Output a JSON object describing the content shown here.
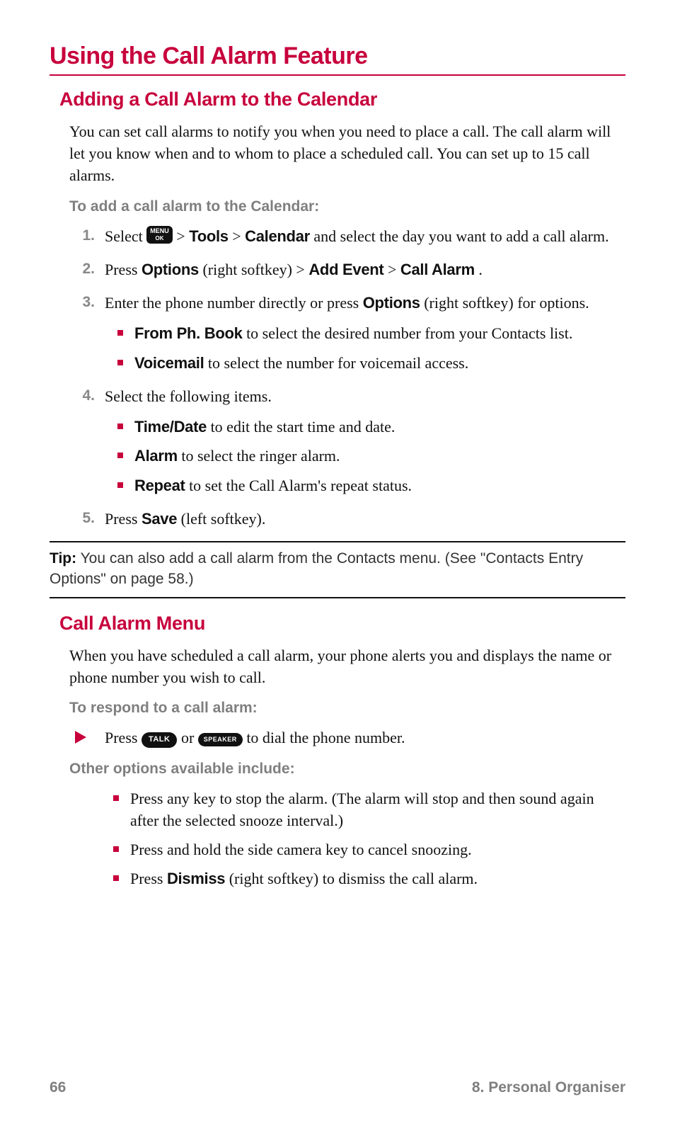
{
  "title": "Using the Call Alarm Feature",
  "section1": {
    "heading": "Adding a Call Alarm to the Calendar",
    "intro": "You can set call alarms to notify you when you need to place a call. The call alarm will let you know when and to whom to place a scheduled call. You can set up to 15 call alarms.",
    "lead": "To add a call alarm to the Calendar:",
    "steps": {
      "s1": {
        "pre": "Select ",
        "menu_top": "MENU",
        "menu_bot": "OK",
        "mid1": " > ",
        "b1": "Tools",
        "mid2": " > ",
        "b2": "Calendar",
        "post": " and select the day you want to add a call alarm."
      },
      "s2": {
        "pre": "Press ",
        "b1": "Options",
        "mid1": " (right softkey) > ",
        "b2": "Add Event",
        "mid2": " > ",
        "b3": "Call Alarm",
        "post": "."
      },
      "s3": {
        "pre": "Enter the phone number directly or press ",
        "b1": "Options",
        "post": " (right softkey) for options.",
        "sub": {
          "a": {
            "b": "From Ph. Book",
            "t": " to select the desired number from your Contacts list."
          },
          "b": {
            "b": "Voicemail",
            "t": " to select the number for voicemail access."
          }
        }
      },
      "s4": {
        "text": "Select the following items.",
        "sub": {
          "a": {
            "b": "Time/Date",
            "t": " to edit the start time and date."
          },
          "b": {
            "b": "Alarm",
            "t": " to select the ringer alarm."
          },
          "c": {
            "b": "Repeat",
            "t": " to set the Call Alarm's repeat status."
          }
        }
      },
      "s5": {
        "pre": "Press ",
        "b1": "Save",
        "post": " (left softkey)."
      }
    }
  },
  "tip": {
    "label": "Tip:",
    "text": " You can also add a call alarm from the Contacts menu. (See \"Contacts Entry Options\" on page 58.)"
  },
  "section2": {
    "heading": "Call Alarm Menu",
    "intro": "When you have scheduled a call alarm, your phone alerts you and displays the name or phone number you wish to call.",
    "lead1": "To respond to a call alarm:",
    "arrow": {
      "pre": "Press ",
      "k1": "TALK",
      "mid": " or ",
      "k2": "SPEAKER",
      "post": " to dial the phone number."
    },
    "lead2": "Other options available include:",
    "opts": {
      "a": "Press any key to stop the alarm. (The alarm will stop and then sound again after the selected snooze interval.)",
      "b": "Press and hold the side camera key to cancel snoozing.",
      "c": {
        "pre": "Press ",
        "b": "Dismiss",
        "post": " (right softkey) to dismiss the call alarm."
      }
    }
  },
  "footer": {
    "page": "66",
    "chapter": "8. Personal Organiser"
  }
}
